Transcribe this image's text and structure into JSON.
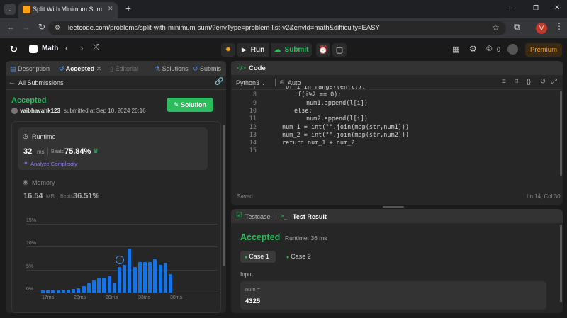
{
  "browser": {
    "tab_title": "Split With Minimum Sum - Leet",
    "new_tab": "+",
    "url": "leetcode.com/problems/split-with-minimum-sum/?envType=problem-list-v2&envId=math&difficulty=EASY",
    "avatar_letter": "V",
    "window_controls": [
      "–",
      "❐",
      "✕"
    ]
  },
  "nav": {
    "list_title": "Math",
    "run_label": "Run",
    "submit_label": "Submit",
    "streak_count": "0",
    "premium_label": "Premium"
  },
  "left_panel": {
    "tabs": [
      "Description",
      "Accepted",
      "Editorial",
      "Solutions",
      "Submis"
    ],
    "back_label": "All Submissions",
    "status": "Accepted",
    "username": "vaibhavahk123",
    "submitted_text": "submitted at Sep 10, 2024 20:16",
    "solution_button": "Solution",
    "runtime": {
      "label": "Runtime",
      "value": "32",
      "unit": "ms",
      "beats_label": "Beats",
      "beats_value": "75.84%",
      "analyze_label": "Analyze Complexity"
    },
    "memory": {
      "label": "Memory",
      "value": "16.54",
      "unit": "MB",
      "beats_label": "Beats",
      "beats_value": "36.51%"
    }
  },
  "chart_data": {
    "type": "bar",
    "title": "",
    "xlabel": "",
    "ylabel": "",
    "ylim": [
      0,
      15
    ],
    "y_ticks": [
      "15%",
      "10%",
      "5%",
      "0%"
    ],
    "x_ticks": [
      "17ms",
      "23ms",
      "28ms",
      "33ms",
      "38ms"
    ],
    "values": [
      0.5,
      0.5,
      0.5,
      0.5,
      0.6,
      0.6,
      0.8,
      1.0,
      1.4,
      2.0,
      2.6,
      3.3,
      3.3,
      3.6,
      2.0,
      5.6,
      6.1,
      9.6,
      5.6,
      6.6,
      6.6,
      6.6,
      7.3,
      6.0,
      6.5,
      4.0
    ],
    "highlight_index": 15,
    "bar_color": "#1673e6",
    "grid": true
  },
  "code_panel": {
    "title": "Code",
    "language": "Python3",
    "auto_label": "Auto",
    "lines": [
      {
        "n": "7",
        "indent": 2,
        "text": "for i in range(len(l)):"
      },
      {
        "n": "8",
        "indent": 3,
        "text": "if(i%2 == 0):"
      },
      {
        "n": "9",
        "indent": 4,
        "text": "num1.append(l[i])"
      },
      {
        "n": "10",
        "indent": 3,
        "text": "else:"
      },
      {
        "n": "11",
        "indent": 4,
        "text": "num2.append(l[i])"
      },
      {
        "n": "12",
        "indent": 2,
        "text": "num_1 = int(\"\".join(map(str,num1)))"
      },
      {
        "n": "13",
        "indent": 2,
        "text": "num_2 = int(\"\".join(map(str,num2)))"
      },
      {
        "n": "14",
        "indent": 2,
        "text": "return num_1 + num_2"
      },
      {
        "n": "15",
        "indent": 0,
        "text": ""
      }
    ],
    "saved_label": "Saved",
    "cursor_pos": "Ln 14, Col 30"
  },
  "test_panel": {
    "tab_testcase": "Testcase",
    "tab_result": "Test Result",
    "status": "Accepted",
    "runtime_text": "Runtime: 36 ms",
    "cases": [
      "Case 1",
      "Case 2"
    ],
    "input_label": "Input",
    "var_name": "num =",
    "var_value": "4325"
  },
  "colors": {
    "accent_green": "#2cbb5d",
    "accent_orange": "#ffa116",
    "bar_blue": "#1673e6",
    "panel_bg": "#262626"
  }
}
